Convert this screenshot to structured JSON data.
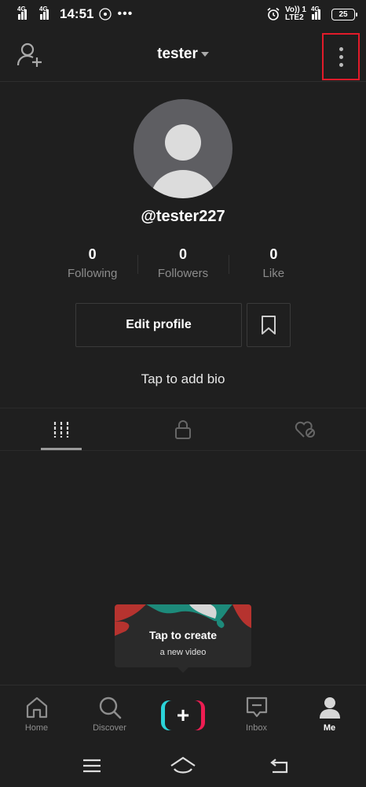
{
  "status_bar": {
    "sim1_network": "4G",
    "sim2_network": "4G",
    "time": "14:51",
    "extra_dots": "•••",
    "volte_label": "Vo)) 1",
    "lte_label": "LTE2",
    "network_right": "4G",
    "battery": "25"
  },
  "header": {
    "title": "tester"
  },
  "profile": {
    "username": "@tester227",
    "stats": [
      {
        "value": "0",
        "label": "Following"
      },
      {
        "value": "0",
        "label": "Followers"
      },
      {
        "value": "0",
        "label": "Like"
      }
    ],
    "edit_label": "Edit profile",
    "bio_prompt": "Tap to add bio"
  },
  "tabs": [
    "videos-grid-icon",
    "lock-icon",
    "liked-hidden-icon"
  ],
  "create_tip": {
    "title": "Tap to create",
    "subtitle": "a new video"
  },
  "bottom_nav": [
    {
      "label": "Home",
      "icon": "home-icon"
    },
    {
      "label": "Discover",
      "icon": "search-icon"
    },
    {
      "label": "",
      "icon": "plus-icon"
    },
    {
      "label": "Inbox",
      "icon": "inbox-icon"
    },
    {
      "label": "Me",
      "icon": "person-icon",
      "active": true
    }
  ],
  "colors": {
    "background": "#1f1f1f",
    "highlight_box": "#e21b2a",
    "create_cyan": "#2bd4d9",
    "create_red": "#ee1d52"
  }
}
